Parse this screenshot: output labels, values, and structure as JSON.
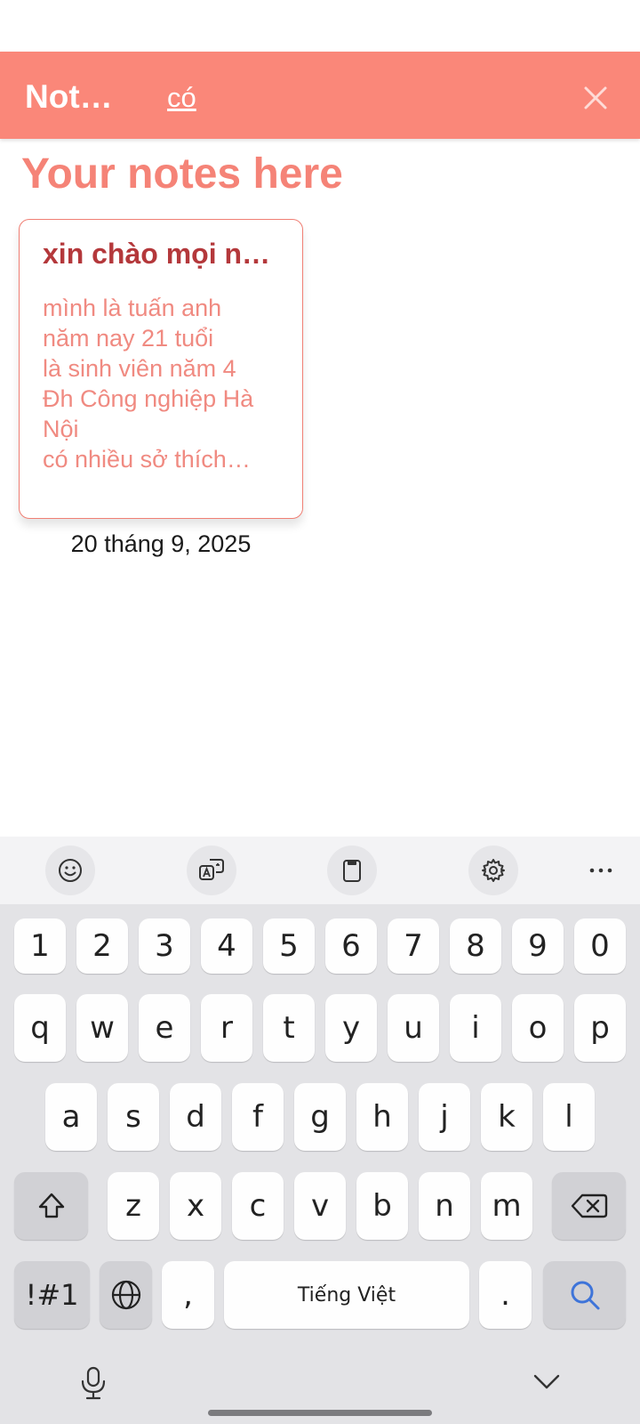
{
  "app_bar": {
    "title": "Notes App",
    "search_value": "có"
  },
  "main": {
    "heading": "Your notes here",
    "notes": [
      {
        "title": "xin chào mọi người",
        "body": "mình là tuấn anh\nnăm nay 21 tuổi\nlà sinh viên năm 4\nĐh Công nghiệp Hà Nội\ncó nhiều sở thích…",
        "date": "20 tháng 9, 2025"
      }
    ]
  },
  "keyboard": {
    "number_row": [
      "1",
      "2",
      "3",
      "4",
      "5",
      "6",
      "7",
      "8",
      "9",
      "0"
    ],
    "row1": [
      "q",
      "w",
      "e",
      "r",
      "t",
      "y",
      "u",
      "i",
      "o",
      "p"
    ],
    "row2": [
      "a",
      "s",
      "d",
      "f",
      "g",
      "h",
      "j",
      "k",
      "l"
    ],
    "row3": [
      "z",
      "x",
      "c",
      "v",
      "b",
      "n",
      "m"
    ],
    "symbols_label": "!#1",
    "comma_label": ",",
    "space_label": "Tiếng Việt",
    "period_label": ".",
    "accent_color": "#3e74d9",
    "toolbar_icons": [
      "emoji-icon",
      "translate-icon",
      "clipboard-icon",
      "settings-icon",
      "more-icon"
    ]
  },
  "colors": {
    "app_bar": "#fa8779",
    "heading": "#f58377",
    "note_title": "#b4383b",
    "note_body": "#f08a81"
  }
}
